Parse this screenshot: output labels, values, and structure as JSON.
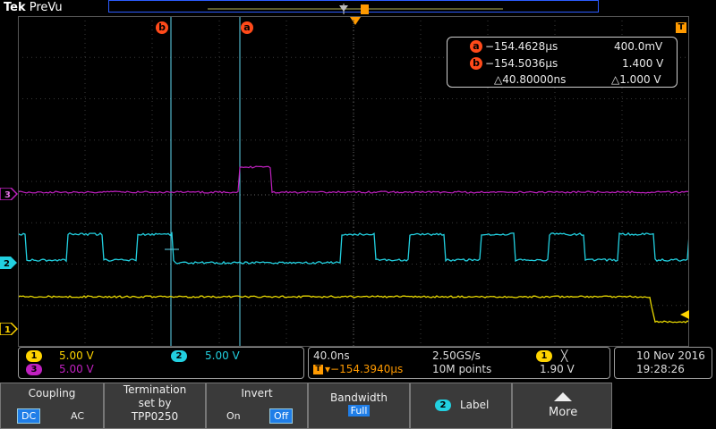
{
  "brand": {
    "bold": "Tek",
    "rest": "PreVu"
  },
  "markers": {
    "trigger": "T"
  },
  "cursor_a": {
    "label": "a"
  },
  "cursor_b": {
    "label": "b"
  },
  "readout": {
    "a_time": "−154.4628µs",
    "a_val": "400.0mV",
    "b_time": "−154.5036µs",
    "b_val": "1.400 V",
    "delta_time": "△40.80000ns",
    "delta_val": "△1.000 V"
  },
  "channels": {
    "ch1": {
      "tag": "1",
      "scale": "5.00 V",
      "color": "#ffd400"
    },
    "ch2": {
      "tag": "2",
      "scale": "5.00 V",
      "color": "#22d0e0"
    },
    "ch3": {
      "tag": "3",
      "scale": "5.00 V",
      "color": "#c020c0"
    }
  },
  "timebase": {
    "per_div": "40.0ns",
    "sample_rate": "2.50GS/s",
    "trigger_pos": "▾−154.3940µs",
    "record": "10M points"
  },
  "trigger": {
    "source": "1",
    "slope": "╳",
    "level": "1.90 V"
  },
  "datetime": {
    "date": "10 Nov 2016",
    "time": "19:28:26"
  },
  "menu": {
    "coupling": {
      "title": "Coupling",
      "opt1": "DC",
      "opt2": "AC"
    },
    "termination": {
      "line1": "Termination",
      "line2": "set by",
      "line3": "TPP0250"
    },
    "invert": {
      "title": "Invert",
      "opt1": "On",
      "opt2": "Off"
    },
    "bandwidth": {
      "title": "Bandwidth",
      "value": "Full"
    },
    "label": {
      "tag": "2",
      "text": "Label"
    },
    "more": {
      "text": "More"
    }
  },
  "colors": {
    "cursor": "#5fd6ee",
    "cursor_badge": "#ff4a1a",
    "grid": "#555555"
  }
}
